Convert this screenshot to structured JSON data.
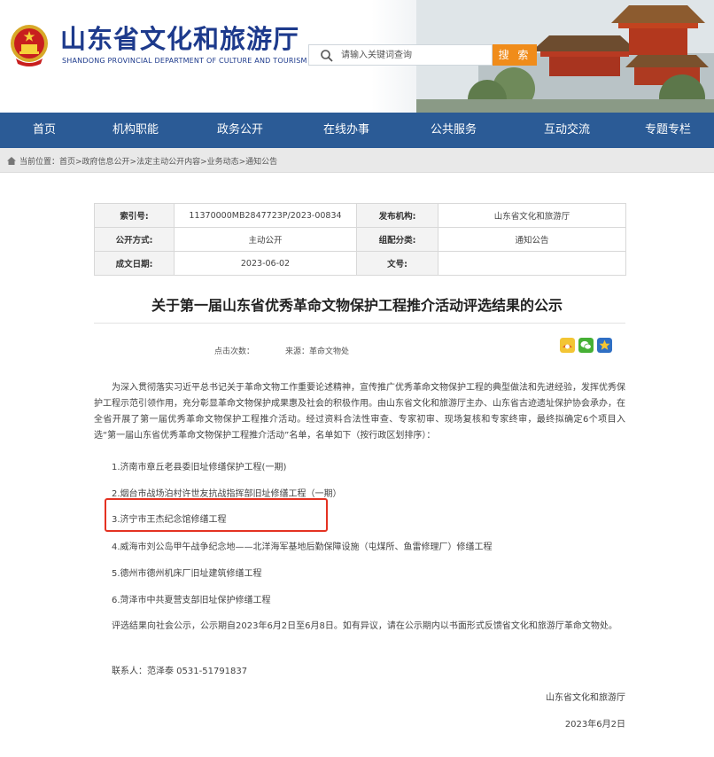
{
  "header": {
    "title": "山东省文化和旅游厅",
    "subtitle": "SHANDONG PROVINCIAL DEPARTMENT OF CULTURE AND TOURISM",
    "search_placeholder": "请输入关键词查询",
    "search_button": "搜 索",
    "emblem_icon": "national-emblem-icon",
    "search_icon": "search-icon"
  },
  "nav": {
    "items": [
      "首页",
      "机构职能",
      "政务公开",
      "在线办事",
      "公共服务",
      "互动交流",
      "专题专栏"
    ]
  },
  "breadcrumb": {
    "label": "当前位置：",
    "path": "首页>政府信息公开>法定主动公开内容>业务动态>通知公告"
  },
  "meta": {
    "index_label": "索引号:",
    "index_value": "11370000MB2847723P/2023-00834",
    "publisher_label": "发布机构:",
    "publisher_value": "山东省文化和旅游厅",
    "open_label": "公开方式:",
    "open_value": "主动公开",
    "category_label": "组配分类:",
    "category_value": "通知公告",
    "date_label": "成文日期:",
    "date_value": "2023-06-02",
    "docno_label": "文号:",
    "docno_value": ""
  },
  "article": {
    "title": "关于第一届山东省优秀革命文物保护工程推介活动评选结果的公示",
    "views_label": "点击次数：",
    "source_label": "来源：",
    "source_value": "革命文物处",
    "share_icons": [
      "share-qzone-icon",
      "share-wechat-icon",
      "favorite-star-icon"
    ],
    "intro": "为深入贯彻落实习近平总书记关于革命文物工作重要论述精神，宣传推广优秀革命文物保护工程的典型做法和先进经验，发挥优秀保护工程示范引领作用，充分彰显革命文物保护成果惠及社会的积极作用。由山东省文化和旅游厅主办、山东省古迹遗址保护协会承办，在全省开展了第一届优秀革命文物保护工程推介活动。经过资料合法性审查、专家初审、现场复核和专家终审，最终拟确定6个项目入选“第一届山东省优秀革命文物保护工程推介活动”名单，名单如下（按行政区划排序）：",
    "items": [
      "1.济南市章丘老县委旧址修缮保护工程(一期)",
      "2.烟台市战场泊村许世友抗战指挥部旧址修缮工程（一期）",
      "3.济宁市王杰纪念馆修缮工程",
      "4.威海市刘公岛甲午战争纪念地——北洋海军基地后勤保障设施（屯煤所、鱼雷修理厂）修缮工程",
      "5.德州市德州机床厂旧址建筑修缮工程",
      "6.菏泽市中共夏营支部旧址保护修缮工程"
    ],
    "closing": "评选结果向社会公示，公示期自2023年6月2日至6月8日。如有异议，请在公示期内以书面形式反馈省文化和旅游厅革命文物处。",
    "contact": "联系人：范泽泰   0531-51791837",
    "signer": "山东省文化和旅游厅",
    "sign_date": "2023年6月2日"
  },
  "colors": {
    "nav_bg": "#2b5b96",
    "title_blue": "#1d3a8c",
    "search_orange": "#f08c1a",
    "highlight_red": "#e43222"
  }
}
